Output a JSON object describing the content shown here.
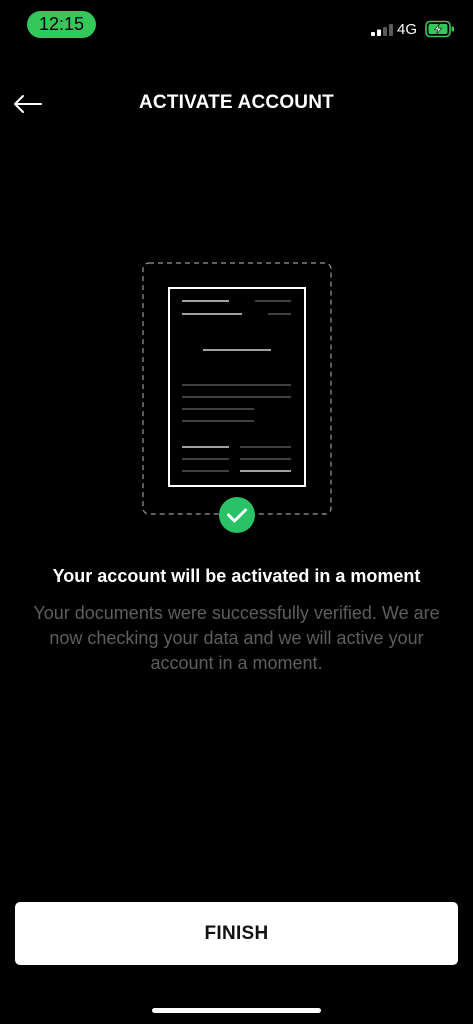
{
  "status_bar": {
    "time": "12:15",
    "network": "4G",
    "icons": [
      "cellular-signal-icon",
      "battery-charging-icon"
    ],
    "time_pill_color": "#34c759"
  },
  "header": {
    "title": "ACTIVATE ACCOUNT",
    "back_icon": "back-arrow-icon"
  },
  "illustration": {
    "icon": "document-illustration",
    "badge_icon": "check-icon",
    "badge_color": "#29c266"
  },
  "main": {
    "heading": "Your account will be activated in a moment",
    "description": "Your documents were successfully verified. We are now checking your data and we will active your account in a moment."
  },
  "footer": {
    "finish_label": "FINISH"
  }
}
